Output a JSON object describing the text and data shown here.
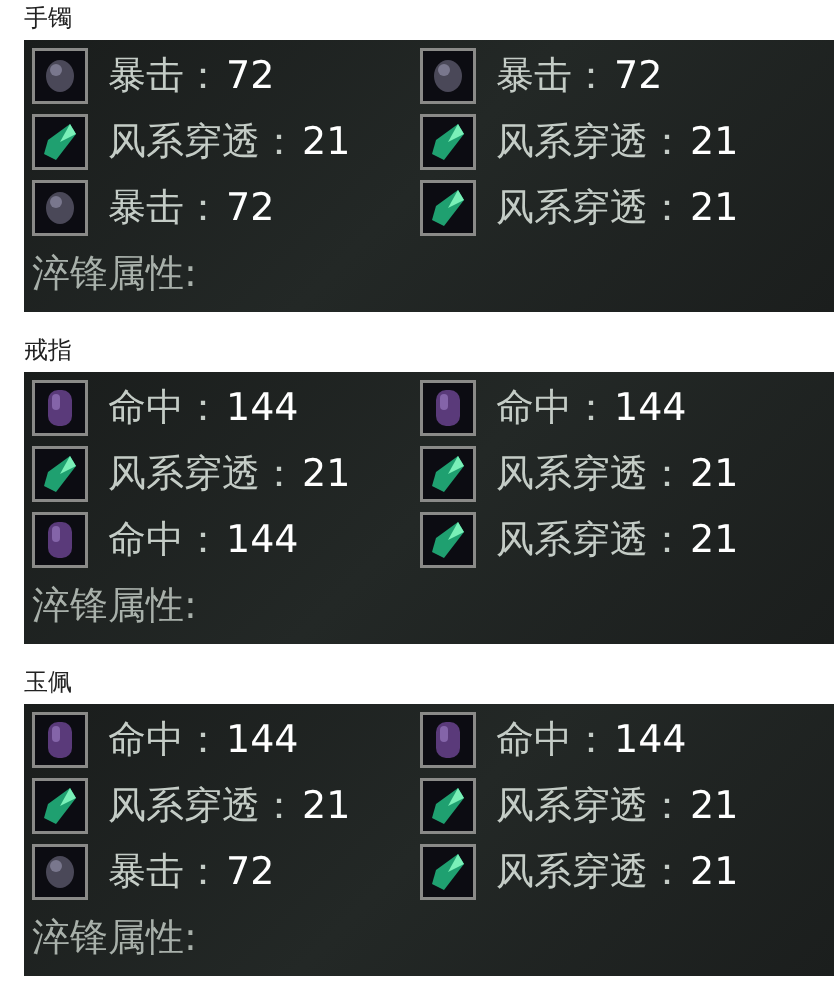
{
  "sections": [
    {
      "title": "手镯",
      "slots": [
        {
          "kind": "dark",
          "name": "暴击：",
          "value": "72"
        },
        {
          "kind": "dark",
          "name": "暴击：",
          "value": "72"
        },
        {
          "kind": "green",
          "name": "风系穿透：",
          "value": "21"
        },
        {
          "kind": "green",
          "name": "风系穿透：",
          "value": "21"
        },
        {
          "kind": "dark",
          "name": "暴击：",
          "value": "72"
        },
        {
          "kind": "green",
          "name": "风系穿透：",
          "value": "21"
        }
      ],
      "footer": "淬锋属性:"
    },
    {
      "title": "戒指",
      "slots": [
        {
          "kind": "purple",
          "name": "命中：",
          "value": "144"
        },
        {
          "kind": "purple",
          "name": "命中：",
          "value": "144"
        },
        {
          "kind": "green",
          "name": "风系穿透：",
          "value": "21"
        },
        {
          "kind": "green",
          "name": "风系穿透：",
          "value": "21"
        },
        {
          "kind": "purple",
          "name": "命中：",
          "value": "144"
        },
        {
          "kind": "green",
          "name": "风系穿透：",
          "value": "21"
        }
      ],
      "footer": "淬锋属性:"
    },
    {
      "title": "玉佩",
      "slots": [
        {
          "kind": "purple",
          "name": "命中：",
          "value": "144"
        },
        {
          "kind": "purple",
          "name": "命中：",
          "value": "144"
        },
        {
          "kind": "green",
          "name": "风系穿透：",
          "value": "21"
        },
        {
          "kind": "green",
          "name": "风系穿透：",
          "value": "21"
        },
        {
          "kind": "dark",
          "name": "暴击：",
          "value": "72"
        },
        {
          "kind": "green",
          "name": "风系穿透：",
          "value": "21"
        }
      ],
      "footer": "淬锋属性:"
    }
  ]
}
